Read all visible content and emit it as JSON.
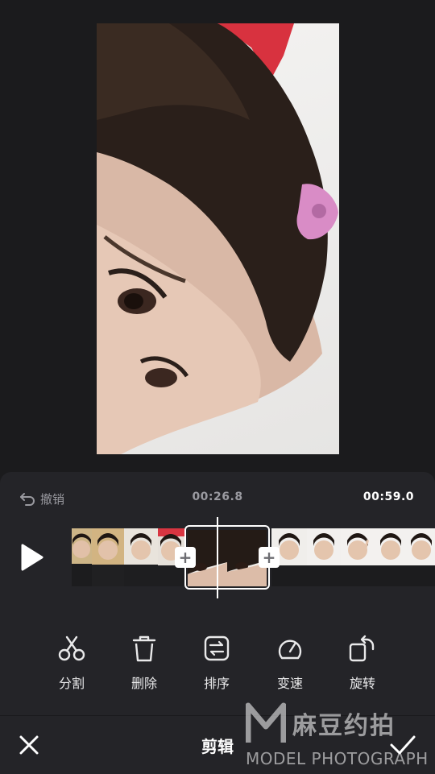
{
  "toolbar": {
    "undo_label": "撤销",
    "current_time": "00:26.8",
    "total_time": "00:59.0"
  },
  "tools": [
    {
      "label": "分割",
      "icon": "scissors-icon"
    },
    {
      "label": "删除",
      "icon": "trash-icon"
    },
    {
      "label": "排序",
      "icon": "sort-icon"
    },
    {
      "label": "变速",
      "icon": "speed-gauge-icon"
    },
    {
      "label": "旋转",
      "icon": "rotate-icon"
    }
  ],
  "bottom": {
    "title": "剪辑"
  },
  "watermark": {
    "logo_letter": "M",
    "chinese": "麻豆约拍",
    "english": "MODEL PHOTOGRAPH"
  },
  "colors": {
    "background": "#1b1b1d",
    "panel": "#242428",
    "text": "#e9e9ea",
    "muted": "#9a9aa0"
  }
}
